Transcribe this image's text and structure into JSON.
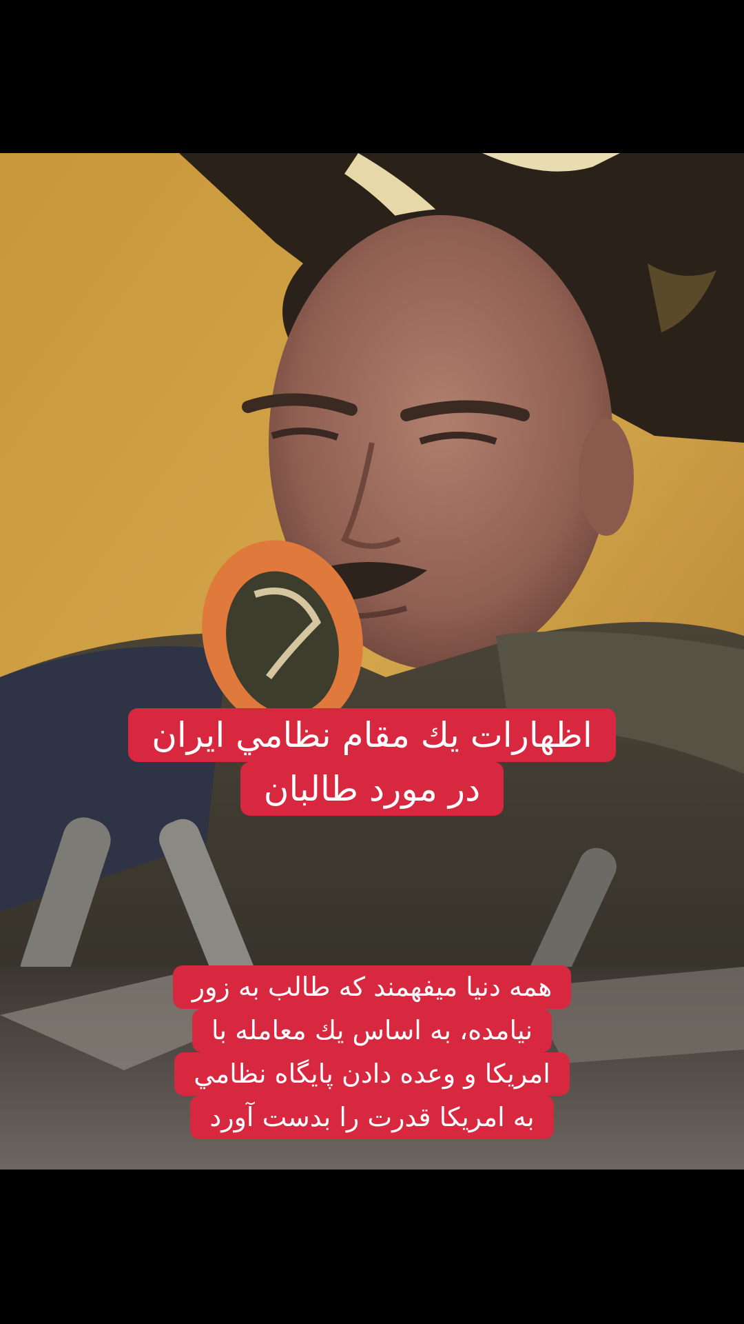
{
  "title_caption": {
    "lines": [
      "اظهارات يك مقام نظامي ايران",
      "در مورد طالبان"
    ]
  },
  "body_caption": {
    "lines": [
      "همه دنيا ميفهمند كه طالب به زور",
      "نيامده، به اساس يك معامله با",
      "امريكا و وعده دادن پايگاه نظامي",
      "به امريكا قدرت را بدست آورد"
    ]
  },
  "colors": {
    "caption_background": "#d8283f",
    "caption_text": "#ffffff",
    "letterbox": "#000000"
  }
}
